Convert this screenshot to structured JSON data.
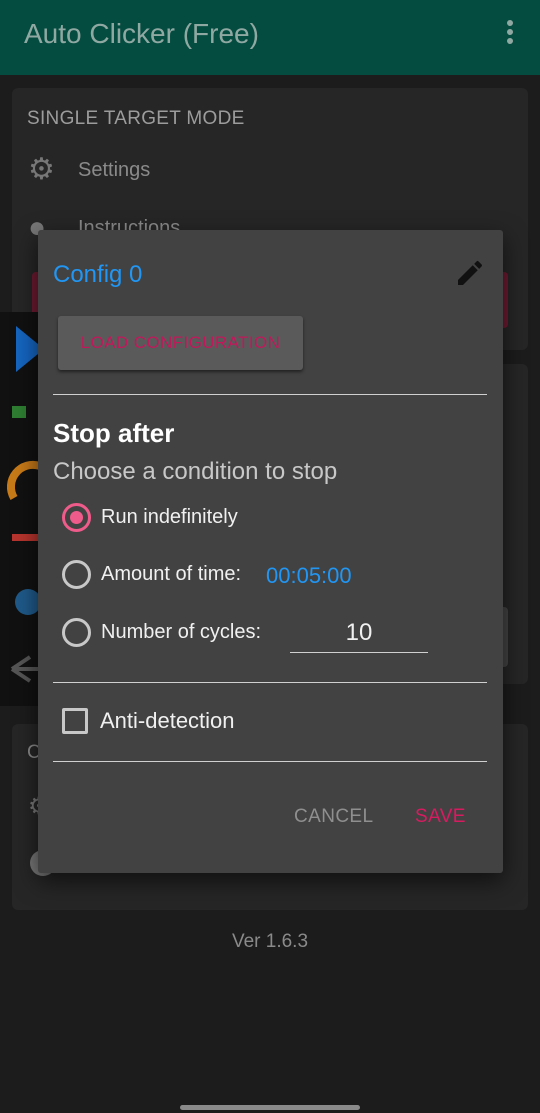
{
  "appbar": {
    "title": "Auto Clicker (Free)"
  },
  "background": {
    "section_title": "SINGLE TARGET MODE",
    "settings_label": "Settings",
    "instructions_label": "Instructions",
    "letter": "C",
    "version": "Ver 1.6.3"
  },
  "dialog": {
    "config_name": "Config 0",
    "load_button": "LOAD CONFIGURATION",
    "stop_title": "Stop after",
    "stop_subtitle": "Choose a condition to stop",
    "options": [
      {
        "label": "Run indefinitely",
        "checked": true
      },
      {
        "label": "Amount of time:",
        "checked": false
      },
      {
        "label": "Number of cycles:",
        "checked": false
      }
    ],
    "time_value": "00:05:00",
    "cycles_value": "10",
    "anti_detection_label": "Anti-detection",
    "anti_detection_checked": false,
    "cancel_label": "CANCEL",
    "save_label": "SAVE"
  },
  "colors": {
    "appbar": "#044c40",
    "accent_blue": "#2196f3",
    "accent_pink": "#d81b60"
  },
  "icons": [
    "overflow-menu-icon",
    "gear-icon",
    "info-icon",
    "pencil-icon"
  ]
}
